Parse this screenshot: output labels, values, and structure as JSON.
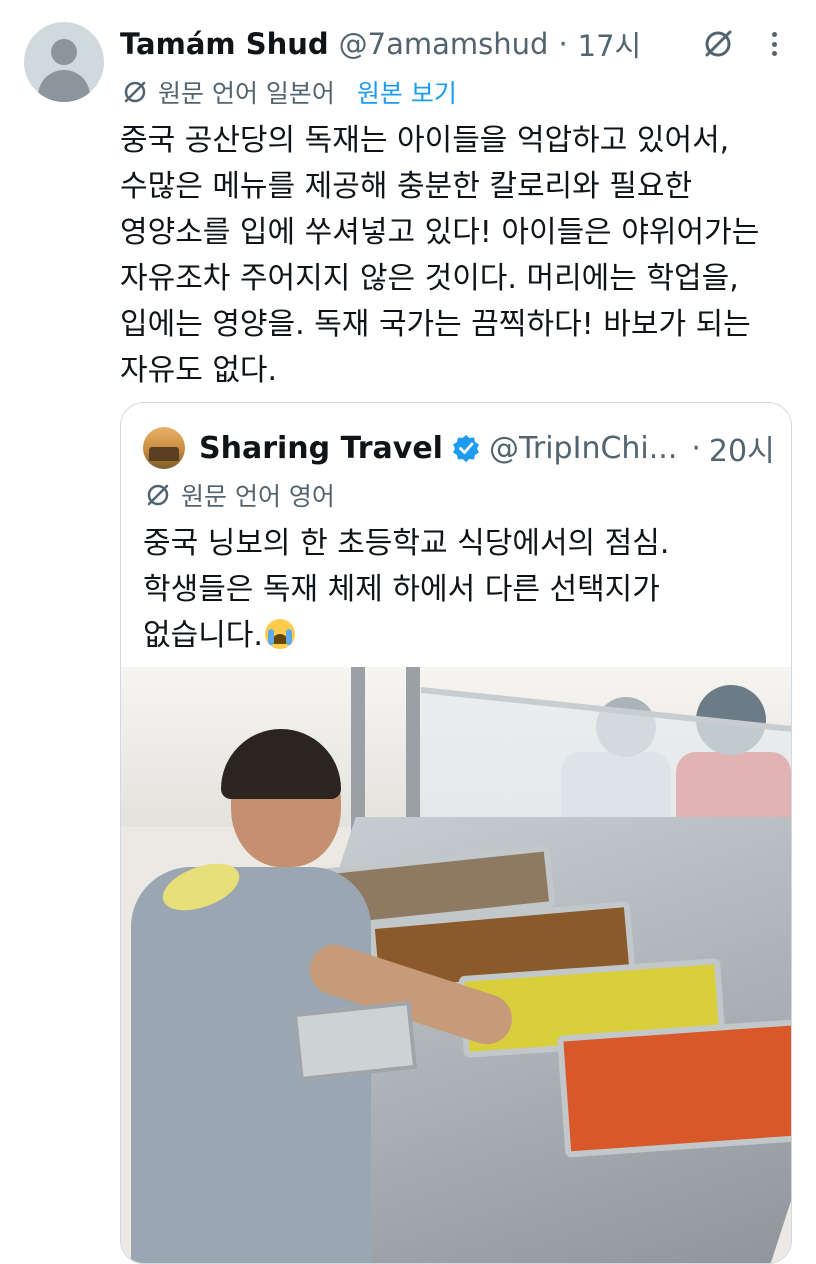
{
  "tweet": {
    "display_name": "Tamám Shud",
    "handle": "@7amamshud",
    "separator": "·",
    "time": "17시",
    "translation_label": "원문 언어 일본어",
    "show_original": "원본 보기",
    "text_lines": [
      "중국 공산당의 독재는 아이들을 억압하고 있어서,",
      "수많은 메뉴를 제공해 충분한 칼로리와 필요한",
      "영양소를 입에 쑤셔넣고 있다! 아이들은 야위어가는",
      "자유조차 주어지지 않은 것이다. 머리에는 학업을,",
      "입에는 영양을. 독재 국가는 끔찍하다! 바보가 되는",
      "자유도 없다."
    ]
  },
  "quote": {
    "display_name": "Sharing Travel",
    "handle": "@TripInChi...",
    "separator": "·",
    "time": "20시",
    "translation_label": "원문 언어 영어",
    "text_lines": [
      "중국 닝보의 한 초등학교 식당에서의 점심.",
      "학생들은 독재 체제 하에서 다른 선택지가",
      "없습니다."
    ]
  },
  "colors": {
    "link": "#1d9bf0",
    "secondary_text": "#536471",
    "verified": "#1d9bf0",
    "border": "#cfd9de"
  },
  "icons": {
    "avatar": "default-avatar-icon",
    "grok": "grok-icon",
    "more": "more-vertical-icon",
    "translate": "translate-icon",
    "verified": "verified-badge-icon",
    "emoji": "loudly-crying-face-emoji"
  }
}
